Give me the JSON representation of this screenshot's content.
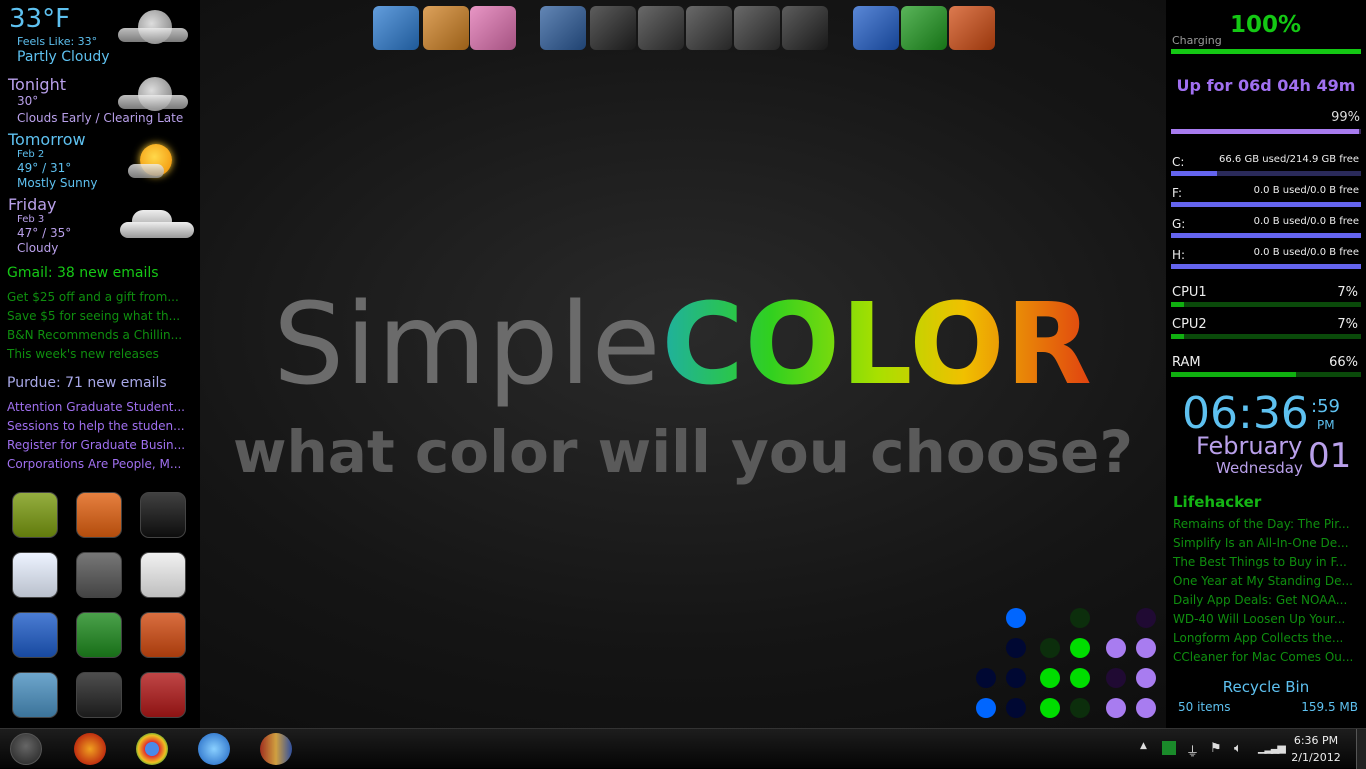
{
  "weather": {
    "current": {
      "temp": "33°F",
      "feels": "Feels Like: 33°",
      "cond": "Partly Cloudy",
      "icon": "moon-cloud-icon"
    },
    "tonight": {
      "label": "Tonight",
      "temp": "30°",
      "cond": "Clouds Early / Clearing Late",
      "icon": "moon-cloud-icon"
    },
    "tomorrow": {
      "label": "Tomorrow",
      "date": "Feb 2",
      "temp": "49° / 31°",
      "cond": "Mostly Sunny",
      "icon": "sun-cloud-icon"
    },
    "friday": {
      "label": "Friday",
      "date": "Feb 3",
      "temp": "47° / 35°",
      "cond": "Cloudy",
      "icon": "cloud-icon"
    }
  },
  "gmail": {
    "header": "Gmail: 38 new emails",
    "items": [
      "Get $25 off and a gift from...",
      "Save $5 for seeing what th...",
      "B&N Recommends a Chillin...",
      "This week's new releases"
    ]
  },
  "purdue": {
    "header": "Purdue: 71 new emails",
    "items": [
      "Attention Graduate Student...",
      "Sessions to help the studen...",
      "Register for Graduate Busin...",
      "Corporations Are People, M..."
    ]
  },
  "launcher_icons": [
    "deviantart",
    "firefox",
    "tweetdeck",
    "feather",
    "camera",
    "paint-palette",
    "word",
    "excel",
    "powerpoint",
    "finder",
    "terminal",
    "tools"
  ],
  "dock_icons": [
    "photoshop",
    "app-store",
    "lotus",
    "computer",
    "folder",
    "pictures-folder",
    "music-folder",
    "videos-folder",
    "documents-folder",
    "word",
    "excel",
    "powerpoint"
  ],
  "wallpaper": {
    "word1": "Simple",
    "word2": "COLOR",
    "tagline": "what color will you choose?"
  },
  "system": {
    "battery": {
      "percent": "100%",
      "status": "Charging",
      "fill": 100
    },
    "uptime": "Up for 06d 04h 49m",
    "uptime_pct": "99%",
    "uptime_fill": 99,
    "drives": [
      {
        "label": "C:",
        "text": "66.6 GB used/214.9 GB free",
        "fill": 24
      },
      {
        "label": "F:",
        "text": "0.0 B used/0.0 B free",
        "fill": 100
      },
      {
        "label": "G:",
        "text": "0.0 B used/0.0 B free",
        "fill": 100
      },
      {
        "label": "H:",
        "text": "0.0 B used/0.0 B free",
        "fill": 100
      }
    ],
    "cpu1": {
      "label": "CPU1",
      "value": "7%",
      "fill": 7
    },
    "cpu2": {
      "label": "CPU2",
      "value": "7%",
      "fill": 7
    },
    "ram": {
      "label": "RAM",
      "value": "66%",
      "fill": 66
    }
  },
  "clock": {
    "time": "06:36",
    "seconds": ":59",
    "ampm": "PM",
    "month": "February",
    "weekday": "Wednesday",
    "day": "01"
  },
  "lifehacker": {
    "header": "Lifehacker",
    "items": [
      "Remains of the Day: The Pir...",
      "Simplify Is an All-In-One De...",
      "The Best Things to Buy in F...",
      "One Year at My Standing De...",
      "Daily App Deals: Get NOAA...",
      "WD-40 Will Loosen Up Your...",
      "Longform App Collects the...",
      "CCleaner for Mac Comes Ou..."
    ]
  },
  "recycle": {
    "label": "Recycle Bin",
    "items": "50 items",
    "size": "159.5 MB"
  },
  "binary_clock": {
    "colors": {
      "blue": "#0066ff",
      "blue_off": "#000833",
      "green": "#00dd00",
      "green_off": "#0c2e0c",
      "purple": "#a87cf0",
      "purple_off": "#200a33"
    },
    "columns": [
      [
        null,
        null,
        0,
        1
      ],
      [
        1,
        0,
        0,
        0
      ],
      [
        null,
        0,
        1,
        1
      ],
      [
        0,
        1,
        1,
        0
      ],
      [
        null,
        1,
        0,
        1
      ],
      [
        0,
        1,
        1,
        1
      ]
    ]
  },
  "taskbar": {
    "apps": [
      "firefox",
      "chrome",
      "itunes",
      "library"
    ],
    "time": "6:36 PM",
    "date": "2/1/2012"
  }
}
